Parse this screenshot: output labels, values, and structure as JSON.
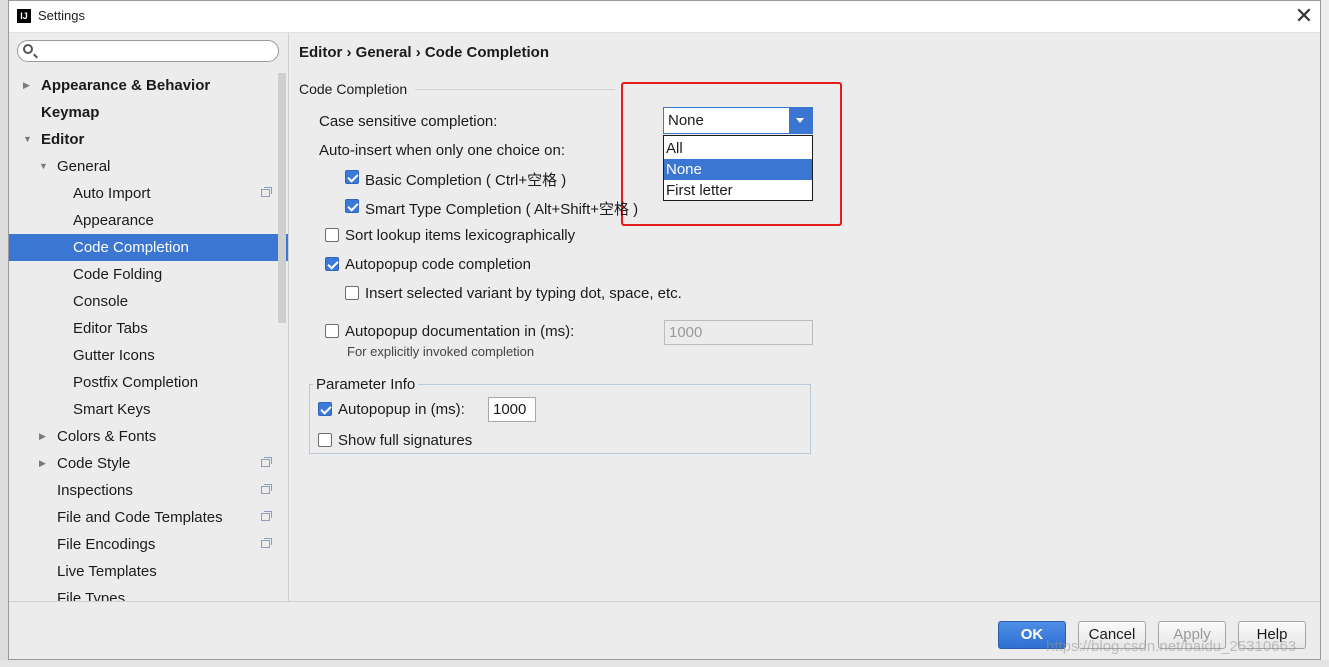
{
  "window": {
    "title": "Settings",
    "logo_text": "IJ"
  },
  "search": {
    "placeholder": "",
    "value": ""
  },
  "sidebar": {
    "items": [
      {
        "label": "Appearance & Behavior",
        "level": 0,
        "arrow": "▶",
        "bold": true
      },
      {
        "label": "Keymap",
        "level": 0,
        "arrow": "",
        "bold": true
      },
      {
        "label": "Editor",
        "level": 0,
        "arrow": "▼",
        "bold": true
      },
      {
        "label": "General",
        "level": 1,
        "arrow": "▼"
      },
      {
        "label": "Auto Import",
        "level": 2,
        "project_icon": true
      },
      {
        "label": "Appearance",
        "level": 2
      },
      {
        "label": "Code Completion",
        "level": 2,
        "selected": true
      },
      {
        "label": "Code Folding",
        "level": 2
      },
      {
        "label": "Console",
        "level": 2
      },
      {
        "label": "Editor Tabs",
        "level": 2
      },
      {
        "label": "Gutter Icons",
        "level": 2
      },
      {
        "label": "Postfix Completion",
        "level": 2
      },
      {
        "label": "Smart Keys",
        "level": 2
      },
      {
        "label": "Colors & Fonts",
        "level": 1,
        "arrow": "▶"
      },
      {
        "label": "Code Style",
        "level": 1,
        "arrow": "▶",
        "project_icon": true
      },
      {
        "label": "Inspections",
        "level": 1,
        "project_icon": true
      },
      {
        "label": "File and Code Templates",
        "level": 1,
        "project_icon": true
      },
      {
        "label": "File Encodings",
        "level": 1,
        "project_icon": true
      },
      {
        "label": "Live Templates",
        "level": 1
      },
      {
        "label": "File Types",
        "level": 1
      }
    ]
  },
  "content": {
    "breadcrumb": "Editor › General › Code Completion",
    "section_title": "Code Completion",
    "case_sensitive_label": "Case sensitive completion:",
    "case_sensitive_value": "None",
    "case_sensitive_options": [
      "All",
      "None",
      "First letter"
    ],
    "auto_insert_label": "Auto-insert when only one choice on:",
    "basic_completion": {
      "label": "Basic Completion ( Ctrl+空格 )",
      "checked": true
    },
    "smart_type_completion": {
      "label": "Smart Type Completion ( Alt+Shift+空格 )",
      "checked": true
    },
    "sort_lookup": {
      "label": "Sort lookup items lexicographically",
      "checked": false
    },
    "autopopup_code": {
      "label": "Autopopup code completion",
      "checked": true
    },
    "insert_selected": {
      "label": "Insert selected variant by typing dot, space, etc.",
      "checked": false
    },
    "autopopup_doc": {
      "label": "Autopopup documentation in (ms):",
      "checked": false,
      "value": "1000"
    },
    "autopopup_doc_hint": "For explicitly invoked completion",
    "parameter_info": {
      "title": "Parameter Info",
      "autopopup": {
        "label": "Autopopup in (ms):",
        "checked": true,
        "value": "1000"
      },
      "full_signatures": {
        "label": "Show full signatures",
        "checked": false
      }
    }
  },
  "footer": {
    "ok": "OK",
    "cancel": "Cancel",
    "apply": "Apply",
    "help": "Help"
  },
  "watermark": "https://blog.csdn.net/baidu_25310663",
  "colors": {
    "selection": "#3a76d2",
    "highlight_box": "#e21b1b"
  }
}
